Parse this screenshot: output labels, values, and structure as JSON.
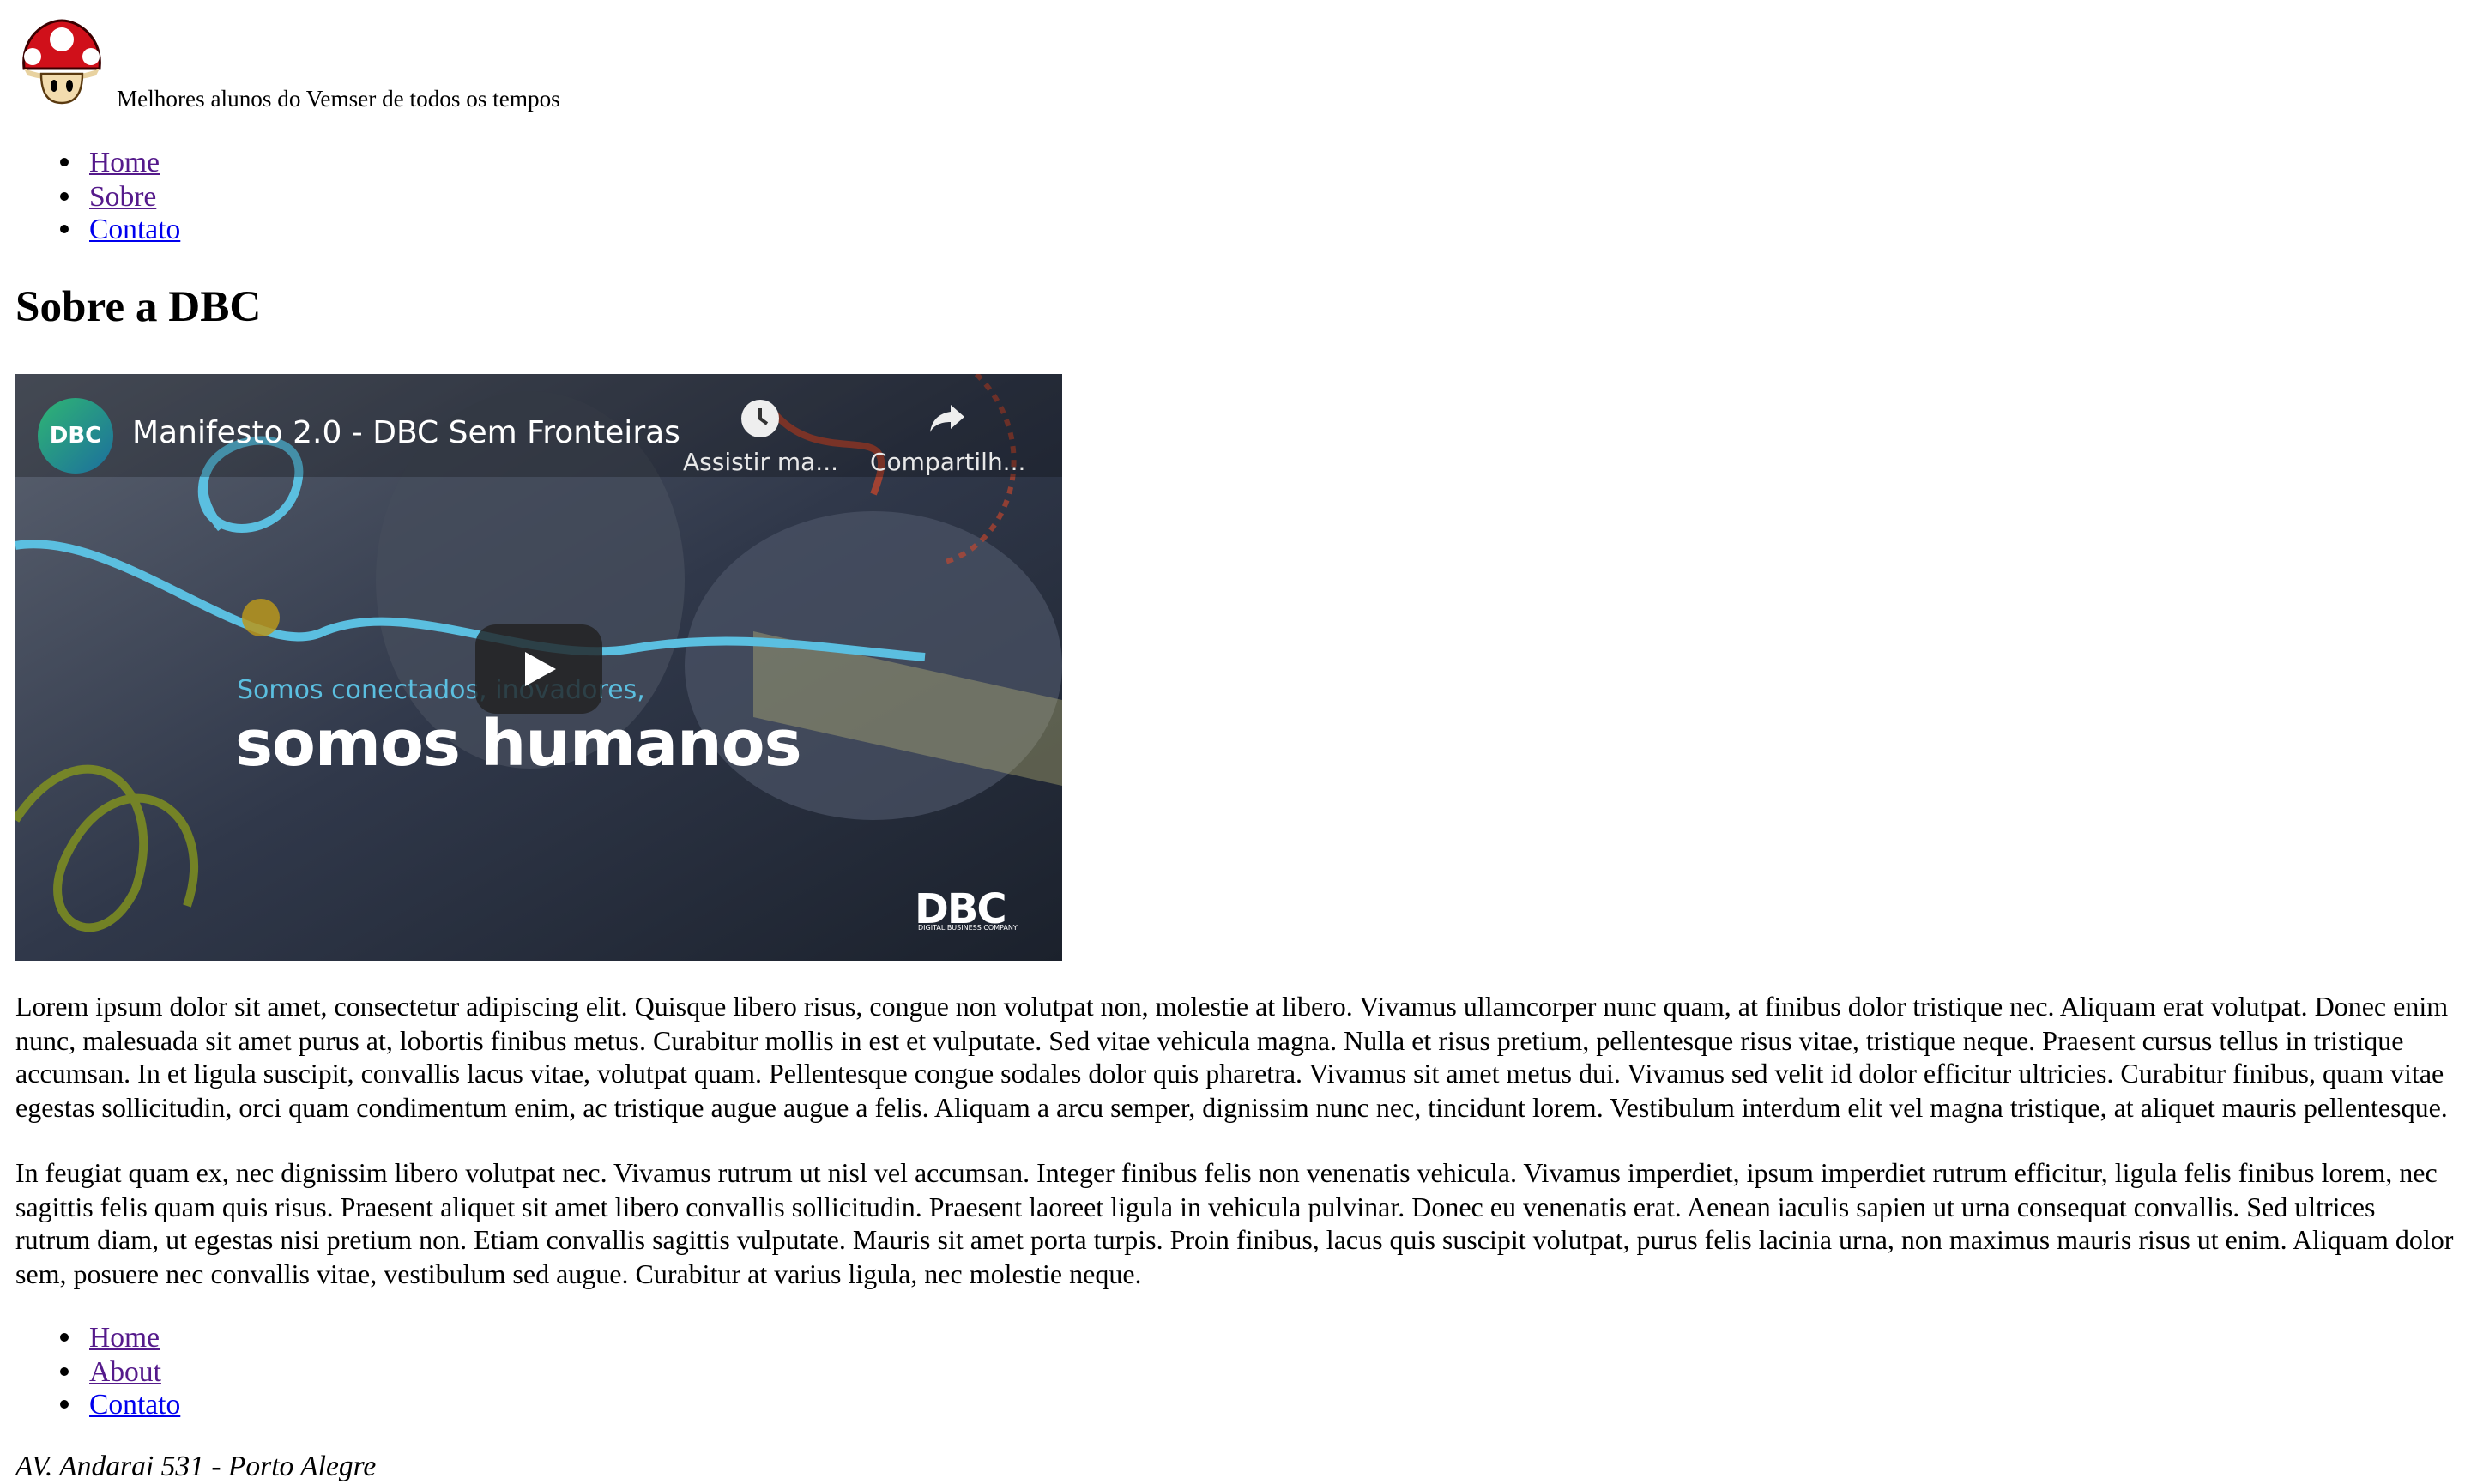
{
  "header": {
    "logo_alt": "Mushroom logo",
    "tagline": "Melhores alunos do Vemser de todos os tempos"
  },
  "nav_top": {
    "items": [
      {
        "label": "Home"
      },
      {
        "label": "Sobre"
      },
      {
        "label": "Contato"
      }
    ]
  },
  "main": {
    "title": "Sobre a DBC",
    "video": {
      "channel_avatar": "DBC",
      "title": "Manifesto 2.0 - DBC Sem Fronteiras",
      "watch_later_label": "Assistir ma...",
      "share_label": "Compartilh...",
      "overlay_small": "Somos conectados, inovadores,",
      "overlay_big": "somos humanos",
      "brand": "DBC",
      "brand_sub": "DIGITAL BUSINESS COMPANY",
      "icons": {
        "watch_later": "clock-icon",
        "share": "share-icon",
        "play": "play-icon"
      }
    },
    "paragraphs": [
      "Lorem ipsum dolor sit amet, consectetur adipiscing elit. Quisque libero risus, congue non volutpat non, molestie at libero. Vivamus ullamcorper nunc quam, at finibus dolor tristique nec. Aliquam erat volutpat. Donec enim nunc, malesuada sit amet purus at, lobortis finibus metus. Curabitur mollis in est et vulputate. Sed vitae vehicula magna. Nulla et risus pretium, pellentesque risus vitae, tristique neque. Praesent cursus tellus in tristique accumsan. In et ligula suscipit, convallis lacus vitae, volutpat quam. Pellentesque congue sodales dolor quis pharetra. Vivamus sit amet metus dui. Vivamus sed velit id dolor efficitur ultricies. Curabitur finibus, quam vitae egestas sollicitudin, orci quam condimentum enim, ac tristique augue augue a felis. Aliquam a arcu semper, dignissim nunc nec, tincidunt lorem. Vestibulum interdum elit vel magna tristique, at aliquet mauris pellentesque.",
      "In feugiat quam ex, nec dignissim libero volutpat nec. Vivamus rutrum ut nisl vel accumsan. Integer finibus felis non venenatis vehicula. Vivamus imperdiet, ipsum imperdiet rutrum efficitur, ligula felis finibus lorem, nec sagittis felis quam quis risus. Praesent aliquet sit amet libero convallis sollicitudin. Praesent laoreet ligula in vehicula pulvinar. Donec eu venenatis erat. Aenean iaculis sapien ut urna consequat convallis. Sed ultrices rutrum diam, ut egestas nisi pretium non. Etiam convallis sagittis vulputate. Mauris sit amet porta turpis. Proin finibus, lacus quis suscipit volutpat, purus felis lacinia urna, non maximus mauris risus ut enim. Aliquam dolor sem, posuere nec convallis vitae, vestibulum sed augue. Curabitur at varius ligula, nec molestie neque."
    ]
  },
  "nav_bottom": {
    "items": [
      {
        "label": "Home"
      },
      {
        "label": "About"
      },
      {
        "label": "Contato"
      }
    ]
  },
  "footer": {
    "address": "AV. Andarai 531 - Porto Alegre"
  },
  "colors": {
    "link_visited": "#551a8b",
    "link_unvisited": "#0000ee"
  }
}
